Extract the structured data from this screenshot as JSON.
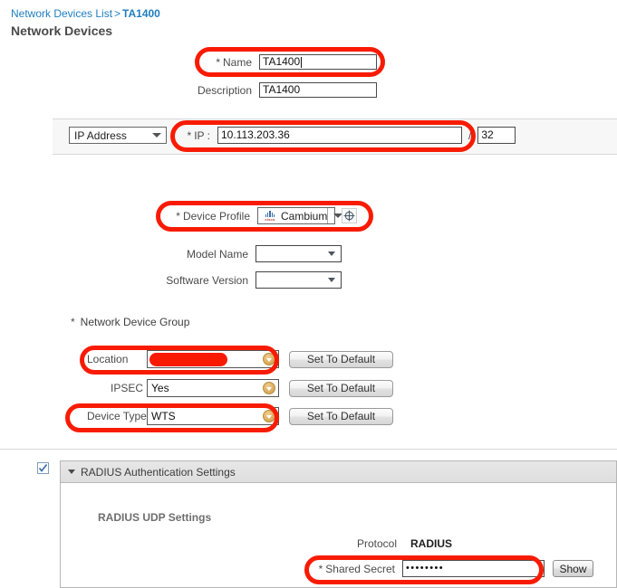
{
  "breadcrumb": {
    "root": "Network Devices List",
    "separator": ">",
    "current": "TA1400"
  },
  "page_title": "Network Devices",
  "form": {
    "name": {
      "label": "Name",
      "required_mark": "*",
      "value": "TA1400"
    },
    "description": {
      "label": "Description",
      "value": "TA1400"
    },
    "ip_type": {
      "value": "IP Address"
    },
    "ip": {
      "label": "IP :",
      "required_mark": "*",
      "value": "10.113.203.36",
      "slash": "/",
      "mask": "32"
    },
    "device_profile": {
      "label": "Device Profile",
      "required_mark": "*",
      "value": "Cambium",
      "brand_icon": "cisco-logo-icon",
      "extra_icon": "globe-target-icon"
    },
    "model_name": {
      "label": "Model Name",
      "value": ""
    },
    "software_version": {
      "label": "Software Version",
      "value": ""
    }
  },
  "network_device_group": {
    "title": "Network Device Group",
    "required_mark": "*",
    "rows": [
      {
        "label": "Location",
        "value": "",
        "redacted": true,
        "button": "Set To Default"
      },
      {
        "label": "IPSEC",
        "value": "Yes",
        "redacted": false,
        "button": "Set To Default"
      },
      {
        "label": "Device Type",
        "value": "WTS",
        "redacted": false,
        "button": "Set To Default"
      }
    ]
  },
  "radius": {
    "checkbox_checked": true,
    "section_title": "RADIUS Authentication Settings",
    "udp_title": "RADIUS UDP Settings",
    "protocol_label": "Protocol",
    "protocol_value": "RADIUS",
    "shared_secret": {
      "label": "Shared Secret",
      "required_mark": "*",
      "value": "••••••••",
      "show_button": "Show"
    }
  },
  "colors": {
    "annotation": "#f81b02",
    "link": "#1f7ec0",
    "panel": "#f7f7f7"
  }
}
